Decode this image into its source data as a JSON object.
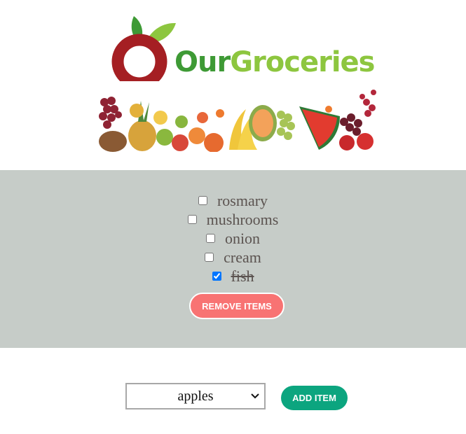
{
  "header": {
    "brand_part1": "Our",
    "brand_part2": "Groceries"
  },
  "list": {
    "items": [
      {
        "label": "rosmary",
        "checked": false
      },
      {
        "label": "mushrooms",
        "checked": false
      },
      {
        "label": "onion",
        "checked": false
      },
      {
        "label": "cream",
        "checked": false
      },
      {
        "label": "fish",
        "checked": true
      }
    ],
    "remove_label": "REMOVE ITEMS"
  },
  "add": {
    "selected_option": "apples",
    "add_label": "ADD ITEM"
  },
  "colors": {
    "panel_bg": "#c6ccc8",
    "remove_button": "#f87373",
    "add_button": "#0ca57f",
    "logo_red": "#a51f23",
    "logo_green": "#8dc63f"
  }
}
